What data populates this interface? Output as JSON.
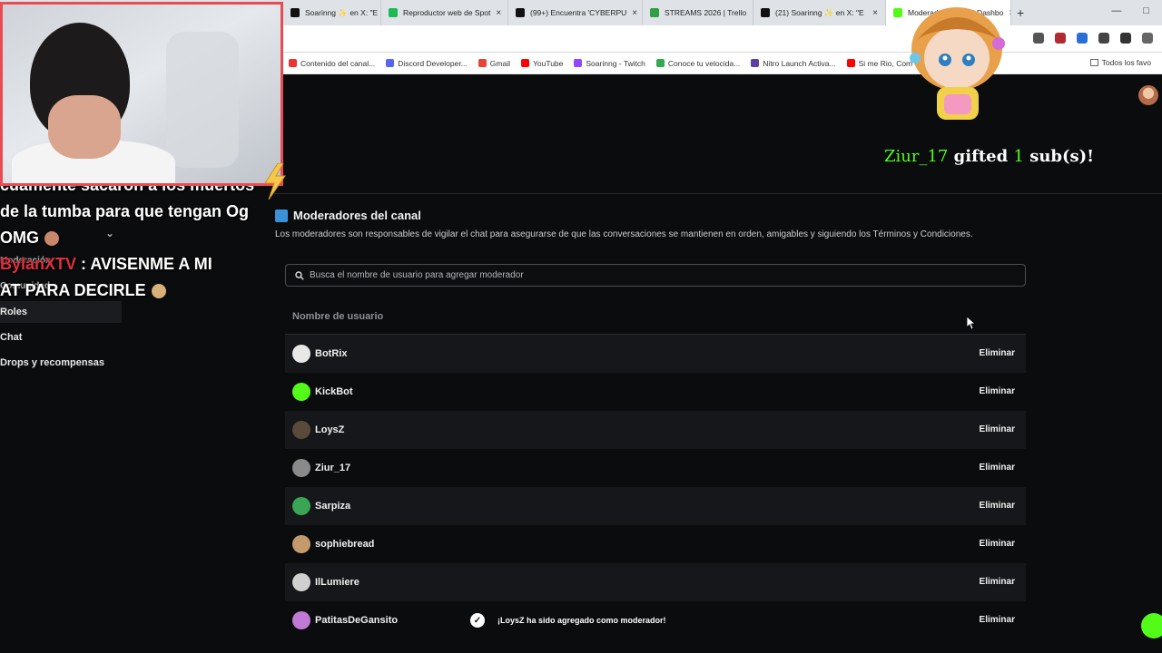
{
  "browser": {
    "tabs": [
      {
        "label": "Soarinng ✨ en X: \"E",
        "color": "#111"
      },
      {
        "label": "Reproductor web de Spot",
        "color": "#1db954"
      },
      {
        "label": "(99+) Encuentra 'CYBERPU",
        "color": "#111"
      },
      {
        "label": "STREAMS 2026 | Trello",
        "color": "#2f9e44"
      },
      {
        "label": "(21) Soarinng ✨ en X: \"E",
        "color": "#111"
      },
      {
        "label": "Moderadores - Kick Dashbo",
        "color": "#53fc18"
      }
    ],
    "window_controls": [
      "—",
      "□"
    ],
    "bookmarks": [
      {
        "label": "Contenido del canal...",
        "color": "#e33"
      },
      {
        "label": "Discord Developer...",
        "color": "#5865f2"
      },
      {
        "label": "Gmail",
        "color": "#ea4335"
      },
      {
        "label": "YouTube",
        "color": "#ff0000"
      },
      {
        "label": "Soarinng - Twitch",
        "color": "#9146ff"
      },
      {
        "label": "Conoce tu velocida...",
        "color": "#34a853"
      },
      {
        "label": "Nitro Launch Activa...",
        "color": "#5b3fa6"
      },
      {
        "label": "Si me Rio, Com",
        "color": "#ff0000"
      }
    ],
    "bookmarks_right": "Todos los favo"
  },
  "stream": {
    "chat_lines": [
      {
        "user": "",
        "text": "cuamente sacaron a los muertos"
      },
      {
        "user": "",
        "text": "de la tumba para que tengan Og"
      },
      {
        "user": "",
        "text": "OMG"
      },
      {
        "user": "BylanXTV",
        "text": ": AVISENME A MI"
      },
      {
        "user": "",
        "text": "AT PARA DECIRLE"
      }
    ],
    "alert": {
      "user": "Ziur_17",
      "pre": "gifted",
      "count": "1",
      "post": "sub(s)!"
    }
  },
  "sidebar": {
    "items": [
      "Moderación",
      "Comunidad",
      "Roles",
      "Chat",
      "Drops y recompensas"
    ]
  },
  "main": {
    "title": "Moderadores del canal",
    "description": "Los moderadores son responsables de vigilar el chat para asegurarse de que las conversaciones se mantienen en orden, amigables y siguiendo los Términos y Condiciones.",
    "search_placeholder": "Busca el nombre de usuario para agregar moderador",
    "column_header": "Nombre de usuario",
    "remove_label": "Eliminar",
    "moderators": [
      {
        "name": "BotRix",
        "avatar_color": "#e8e8e8"
      },
      {
        "name": "KickBot",
        "avatar_color": "#53fc18"
      },
      {
        "name": "LoysZ",
        "avatar_color": "#5a4a3a"
      },
      {
        "name": "Ziur_17",
        "avatar_color": "#8a8a8a"
      },
      {
        "name": "Sarpiza",
        "avatar_color": "#3aa655"
      },
      {
        "name": "sophiebread",
        "avatar_color": "#c49a6c"
      },
      {
        "name": "IlLumiere",
        "avatar_color": "#d0d0d0"
      },
      {
        "name": "PatitasDeGansito",
        "avatar_color": "#c07ad6"
      }
    ],
    "toast": "¡LoysZ ha sido agregado como moderador!"
  }
}
